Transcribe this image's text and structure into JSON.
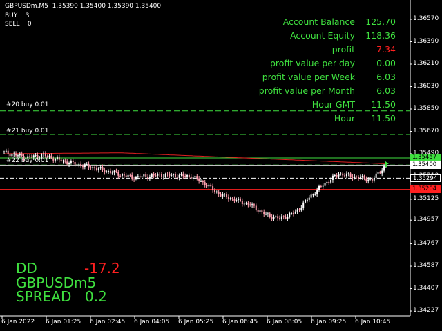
{
  "header": {
    "symbol_line": "GBPUSDm,M5  1.35390 1.35400 1.35390 1.35400",
    "buy_label": "BUY",
    "buy_count": "3",
    "sell_label": "SELL",
    "sell_count": "0"
  },
  "account": [
    {
      "label": "Account Balance",
      "value": "125.70",
      "value_color": "#3fe03f"
    },
    {
      "label": "Account Equity",
      "value": "118.36",
      "value_color": "#3fe03f"
    },
    {
      "label": "profit",
      "value": "-7.34",
      "value_color": "#ff2020"
    },
    {
      "label": "profit value per day",
      "value": "0.00",
      "value_color": "#3fe03f"
    },
    {
      "label": "profit value per Week",
      "value": "6.03",
      "value_color": "#3fe03f"
    },
    {
      "label": "profit value per Month",
      "value": "6.03",
      "value_color": "#3fe03f"
    },
    {
      "label": "Hour GMT",
      "value": "11.50",
      "value_color": "#3fe03f"
    },
    {
      "label": "Hour",
      "value": "11.50",
      "value_color": "#3fe03f"
    }
  ],
  "orders": [
    "#20 buy 0.01",
    "#21 buy 0.01",
    "#22 buy 0.01"
  ],
  "stats": {
    "dd_label": "DD",
    "dd_value": "-17.2",
    "symbol": "GBPUSDm5",
    "spread_label": "SPREAD",
    "spread_value": "0.2"
  },
  "price_axis": [
    "1.36570",
    "1.36390",
    "1.36210",
    "1.36030",
    "1.35850",
    "1.35670",
    "1.35490",
    "1.35310",
    "1.35125",
    "1.34957",
    "1.34767",
    "1.34587",
    "1.34407",
    "1.34227"
  ],
  "price_tags": [
    {
      "price": "1.35457",
      "bg": "#3fe03f",
      "fg": "#000000"
    },
    {
      "price": "1.35400",
      "bg": "#ffffff",
      "fg": "#000000"
    },
    {
      "price": "1.35294",
      "bg": "#000000",
      "fg": "#ffffff"
    },
    {
      "price": "1.35204",
      "bg": "#ff2020",
      "fg": "#000000"
    }
  ],
  "time_axis": [
    "6 Jan 2022",
    "6 Jan 01:25",
    "6 Jan 02:45",
    "6 Jan 04:05",
    "6 Jan 05:25",
    "6 Jan 06:45",
    "6 Jan 08:05",
    "6 Jan 09:25",
    "6 Jan 10:45"
  ],
  "colors": {
    "background": "#000000",
    "text": "#ffffff",
    "accent_green": "#3fe03f",
    "loss_red": "#ff2020",
    "bull_candle": "#ffffff",
    "bear_candle": "#ffa0b0",
    "moving_average": "#e02020"
  }
}
